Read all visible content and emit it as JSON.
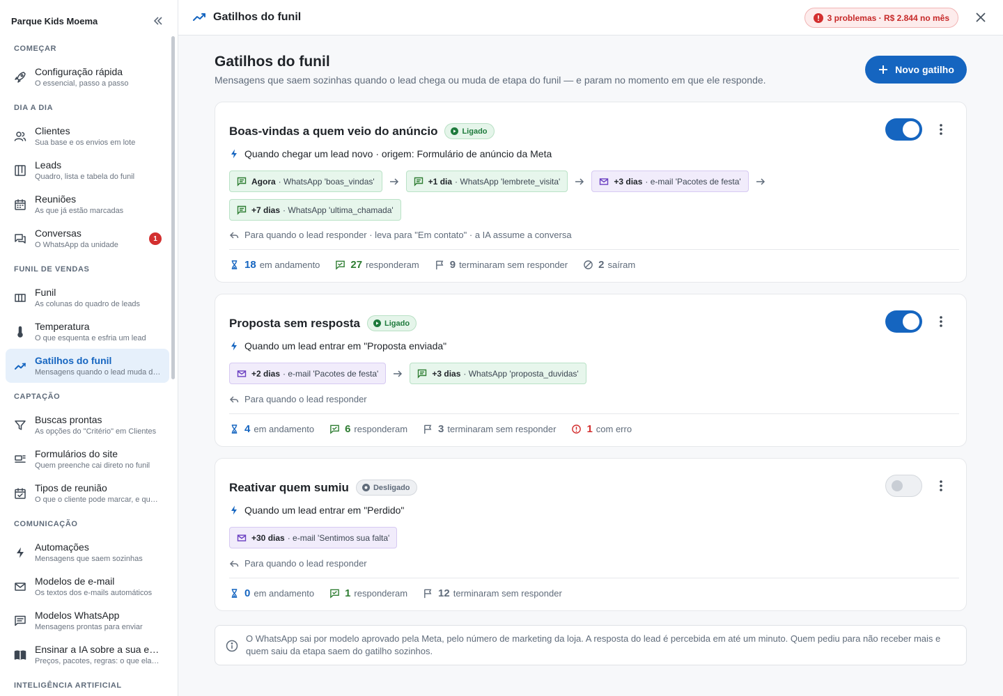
{
  "sidebar": {
    "brand": "Parque Kids Moema",
    "sections": [
      {
        "label": "COMEÇAR",
        "items": [
          {
            "title": "Configuração rápida",
            "subtitle": "O essencial, passo a passo",
            "icon": "rocket-icon"
          }
        ]
      },
      {
        "label": "DIA A DIA",
        "items": [
          {
            "title": "Clientes",
            "subtitle": "Sua base e os envios em lote",
            "icon": "users-icon"
          },
          {
            "title": "Leads",
            "subtitle": "Quadro, lista e tabela do funil",
            "icon": "board-icon"
          },
          {
            "title": "Reuniões",
            "subtitle": "As que já estão marcadas",
            "icon": "calendar-icon"
          },
          {
            "title": "Conversas",
            "subtitle": "O WhatsApp da unidade",
            "icon": "chat-icon",
            "badge": "1"
          }
        ]
      },
      {
        "label": "FUNIL DE VENDAS",
        "items": [
          {
            "title": "Funil",
            "subtitle": "As colunas do quadro de leads",
            "icon": "columns-icon"
          },
          {
            "title": "Temperatura",
            "subtitle": "O que esquenta e esfria um lead",
            "icon": "thermometer-icon"
          },
          {
            "title": "Gatilhos do funil",
            "subtitle": "Mensagens quando o lead muda de etapa",
            "icon": "trend-icon",
            "active": true
          }
        ]
      },
      {
        "label": "CAPTAÇÃO",
        "items": [
          {
            "title": "Buscas prontas",
            "subtitle": "As opções do \"Critério\" em Clientes",
            "icon": "filter-icon"
          },
          {
            "title": "Formulários do site",
            "subtitle": "Quem preenche cai direto no funil",
            "icon": "form-icon"
          },
          {
            "title": "Tipos de reunião",
            "subtitle": "O que o cliente pode marcar, e quando",
            "icon": "calendar-check-icon"
          }
        ]
      },
      {
        "label": "COMUNICAÇÃO",
        "items": [
          {
            "title": "Automações",
            "subtitle": "Mensagens que saem sozinhas",
            "icon": "bolt-icon"
          },
          {
            "title": "Modelos de e-mail",
            "subtitle": "Os textos dos e-mails automáticos",
            "icon": "mail-icon"
          },
          {
            "title": "Modelos WhatsApp",
            "subtitle": "Mensagens prontas para enviar",
            "icon": "message-icon"
          },
          {
            "title": "Ensinar a IA sobre a sua empresa",
            "subtitle": "Preços, pacotes, regras: o que ela precisa saber",
            "icon": "book-icon"
          }
        ]
      },
      {
        "label": "INTELIGÊNCIA ARTIFICIAL",
        "items": []
      }
    ]
  },
  "topbar": {
    "title": "Gatilhos do funil",
    "problems": "3 problemas · R$ 2.844 no mês"
  },
  "page": {
    "title": "Gatilhos do funil",
    "subtitle": "Mensagens que saem sozinhas quando o lead chega ou muda de etapa do funil — e param no momento em que ele responde.",
    "new_button": "Novo gatilho"
  },
  "triggers": [
    {
      "name": "Boas-vindas a quem veio do anúncio",
      "status": "Ligado",
      "enabled": true,
      "condition": "Quando chegar um lead novo · origem: Formulário de anúncio da Meta",
      "steps": [
        {
          "channel": "whatsapp",
          "when": "Agora",
          "detail": "· WhatsApp 'boas_vindas'"
        },
        {
          "channel": "whatsapp",
          "when": "+1 dia",
          "detail": "· WhatsApp 'lembrete_visita'"
        },
        {
          "channel": "email",
          "when": "+3 dias",
          "detail": "· e-mail 'Pacotes de festa'"
        },
        {
          "channel": "whatsapp",
          "when": "+7 dias",
          "detail": "· WhatsApp 'ultima_chamada'"
        }
      ],
      "stop_note": "Para quando o lead responder · leva para \"Em contato\" · a IA assume a conversa",
      "stats": [
        {
          "icon": "hourglass-icon",
          "value": "18",
          "label": "em andamento",
          "tone": "blue"
        },
        {
          "icon": "reply-chat-icon",
          "value": "27",
          "label": "responderam",
          "tone": "green"
        },
        {
          "icon": "flag-icon",
          "value": "9",
          "label": "terminaram sem responder",
          "tone": "grey"
        },
        {
          "icon": "blocked-icon",
          "value": "2",
          "label": "saíram",
          "tone": "grey"
        }
      ]
    },
    {
      "name": "Proposta sem resposta",
      "status": "Ligado",
      "enabled": true,
      "condition": "Quando um lead entrar em \"Proposta enviada\"",
      "steps": [
        {
          "channel": "email",
          "when": "+2 dias",
          "detail": "· e-mail 'Pacotes de festa'"
        },
        {
          "channel": "whatsapp",
          "when": "+3 dias",
          "detail": "· WhatsApp 'proposta_duvidas'"
        }
      ],
      "stop_note": "Para quando o lead responder",
      "stats": [
        {
          "icon": "hourglass-icon",
          "value": "4",
          "label": "em andamento",
          "tone": "blue"
        },
        {
          "icon": "reply-chat-icon",
          "value": "6",
          "label": "responderam",
          "tone": "green"
        },
        {
          "icon": "flag-icon",
          "value": "3",
          "label": "terminaram sem responder",
          "tone": "grey"
        },
        {
          "icon": "error-icon",
          "value": "1",
          "label": "com erro",
          "tone": "red"
        }
      ]
    },
    {
      "name": "Reativar quem sumiu",
      "status": "Desligado",
      "enabled": false,
      "condition": "Quando um lead entrar em \"Perdido\"",
      "steps": [
        {
          "channel": "email",
          "when": "+30 dias",
          "detail": "· e-mail 'Sentimos sua falta'"
        }
      ],
      "stop_note": "Para quando o lead responder",
      "stats": [
        {
          "icon": "hourglass-icon",
          "value": "0",
          "label": "em andamento",
          "tone": "blue"
        },
        {
          "icon": "reply-chat-icon",
          "value": "1",
          "label": "responderam",
          "tone": "green"
        },
        {
          "icon": "flag-icon",
          "value": "12",
          "label": "terminaram sem responder",
          "tone": "grey"
        }
      ]
    }
  ],
  "info": "O WhatsApp sai por modelo aprovado pela Meta, pelo número de marketing da loja. A resposta do lead é percebida em até um minuto. Quem pediu para não receber mais e quem saiu da etapa saem do gatilho sozinhos.",
  "colors": {
    "accent": "#1565c0",
    "success": "#2e7d32",
    "danger": "#d32f2f",
    "email": "#6a3fc1"
  }
}
